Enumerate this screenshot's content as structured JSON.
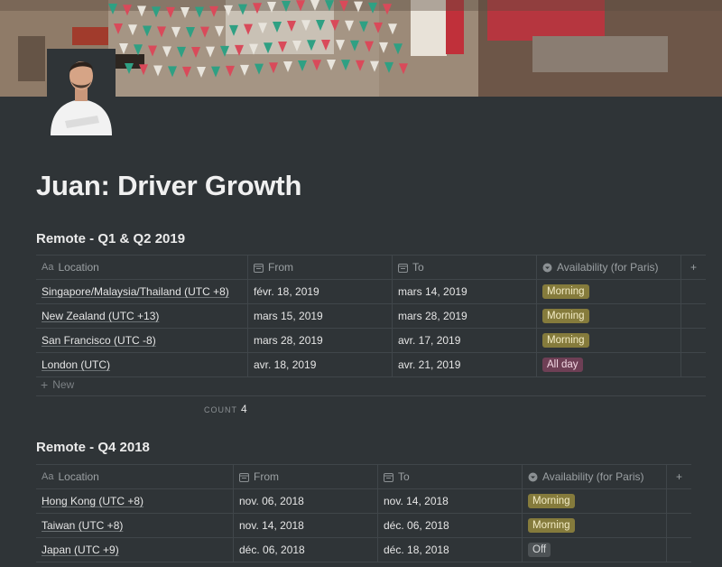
{
  "page": {
    "title": "Juan: Driver Growth"
  },
  "databases": [
    {
      "title": "Remote - Q1 & Q2 2019",
      "columns": [
        "Location",
        "From",
        "To",
        "Availability (for Paris)"
      ],
      "rows": [
        {
          "location": "Singapore/Malaysia/Thailand (UTC +8)",
          "from": "févr. 18, 2019",
          "to": "mars 14, 2019",
          "availability": "Morning"
        },
        {
          "location": "New Zealand (UTC +13)",
          "from": "mars 15, 2019",
          "to": "mars 28, 2019",
          "availability": "Morning"
        },
        {
          "location": "San Francisco (UTC -8)",
          "from": "mars 28, 2019",
          "to": "avr. 17, 2019",
          "availability": "Morning"
        },
        {
          "location": "London (UTC)",
          "from": "avr. 18, 2019",
          "to": "avr. 21, 2019",
          "availability": "All day"
        }
      ],
      "new_label": "New",
      "count_label": "COUNT",
      "count_value": "4",
      "add_column": "+"
    },
    {
      "title": "Remote - Q4 2018",
      "columns": [
        "Location",
        "From",
        "To",
        "Availability (for Paris)"
      ],
      "rows": [
        {
          "location": "Hong Kong (UTC +8)",
          "from": "nov. 06, 2018",
          "to": "nov. 14, 2018",
          "availability": "Morning"
        },
        {
          "location": "Taiwan (UTC +8)",
          "from": "nov. 14, 2018",
          "to": "déc. 06, 2018",
          "availability": "Morning"
        },
        {
          "location": "Japan (UTC +9)",
          "from": "déc. 06, 2018",
          "to": "déc. 18, 2018",
          "availability": "Off"
        }
      ],
      "add_column": "+"
    }
  ],
  "colors": {
    "background": "#2f3437",
    "tag_morning": "#857b3c",
    "tag_all_day": "#6e3f55",
    "tag_off": "#4d5255"
  },
  "icons": {
    "title_property": "text-property-icon",
    "date_property": "calendar-icon",
    "select_property": "select-property-icon"
  }
}
